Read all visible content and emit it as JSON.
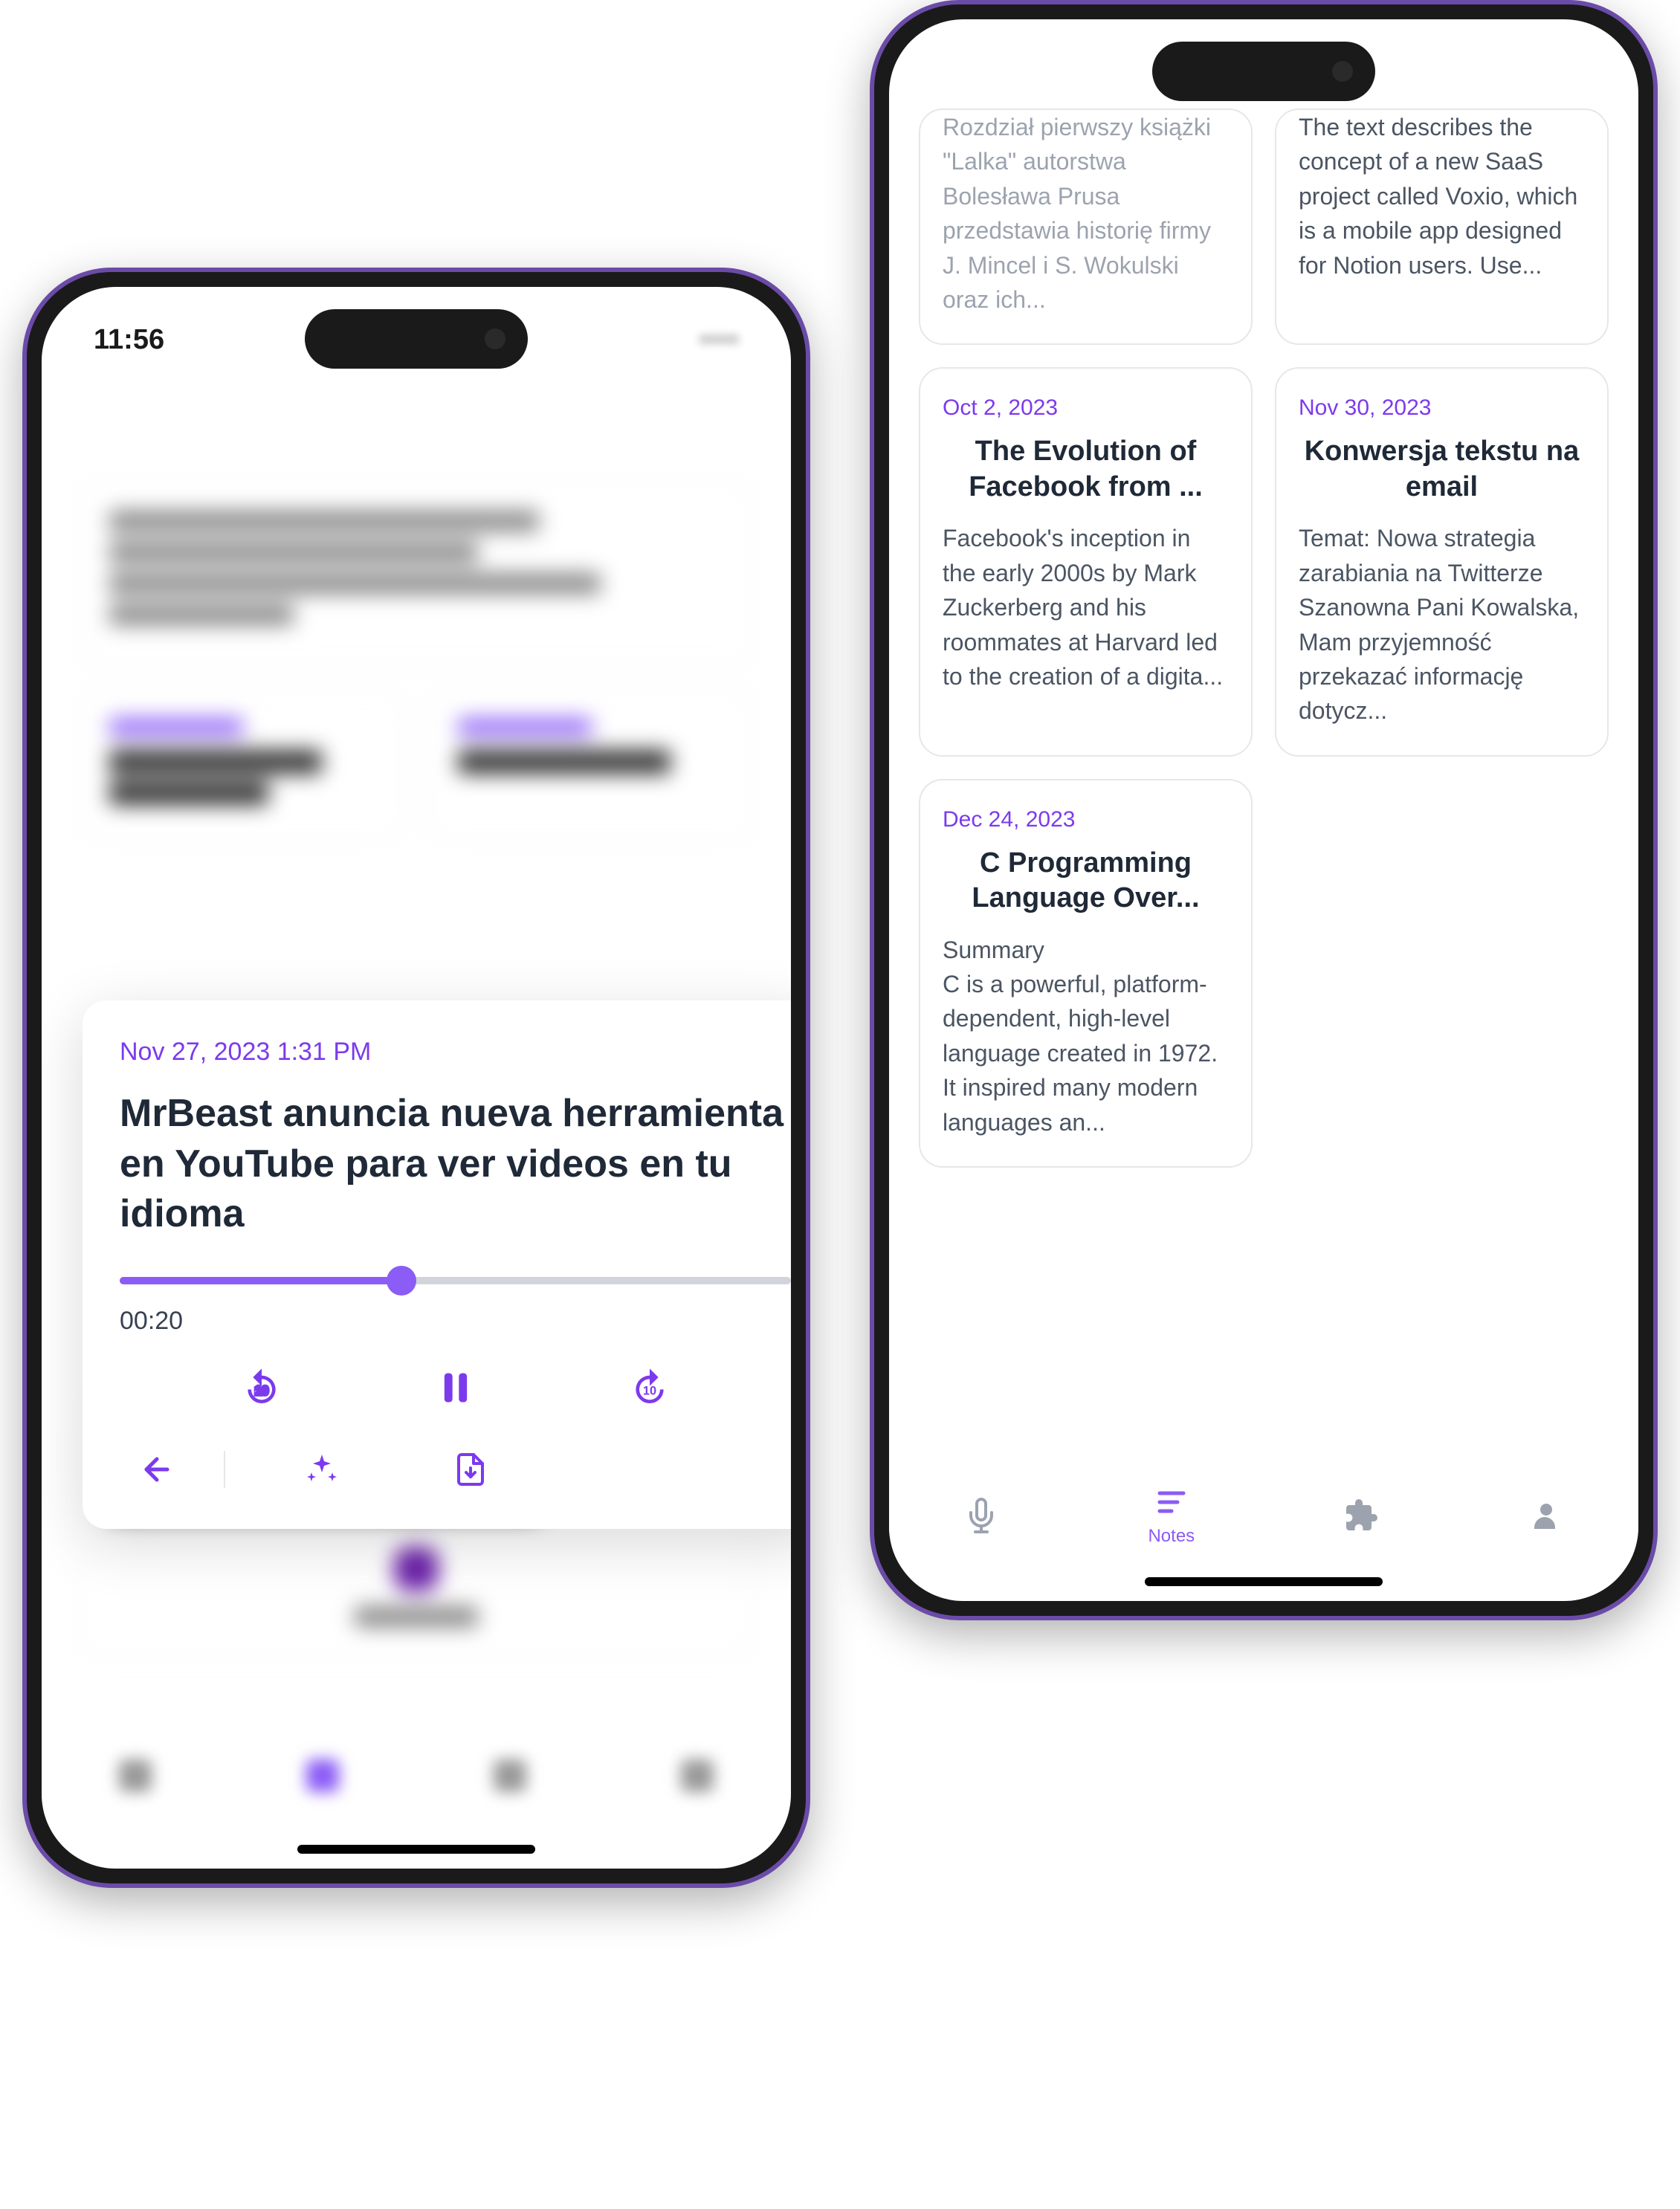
{
  "left_phone": {
    "status_time": "11:56",
    "player": {
      "date": "Nov 27, 2023 1:31 PM",
      "title": "MrBeast anuncia nueva herramienta en YouTube para ver videos en tu idioma",
      "elapsed": "00:20",
      "progress_pct": 42
    }
  },
  "right_phone": {
    "notes": [
      {
        "date": "",
        "title": "",
        "body": "Rozdział pierwszy książki \"Lalka\" autorstwa Bolesława Prusa przedstawia historię firmy J. Mincel i S. Wokulski oraz ich...",
        "partial_top": true,
        "faded": true
      },
      {
        "date": "",
        "title": "",
        "body": "The text describes the concept of a new SaaS project called Voxio, which is a mobile app designed for Notion users. Use...",
        "partial_top": true,
        "faded": false
      },
      {
        "date": "Oct 2, 2023",
        "title": "The Evolution of Facebook from ...",
        "body": "Facebook's inception in the early 2000s by Mark Zuckerberg and his roommates at Harvard led to the creation of a digita..."
      },
      {
        "date": "Nov 30, 2023",
        "title": "Konwersja tekstu na email",
        "body": "Temat: Nowa strategia zarabiania na Twitterze\nSzanowna Pani Kowalska,\nMam przyjemność przekazać informację dotycz..."
      },
      {
        "date": "Dec 24, 2023",
        "title": "C Programming Language Over...",
        "body": "Summary\nC is a powerful, platform-dependent, high-level language created in 1972. It inspired many modern languages an..."
      }
    ],
    "nav": {
      "active_label": "Notes"
    }
  }
}
